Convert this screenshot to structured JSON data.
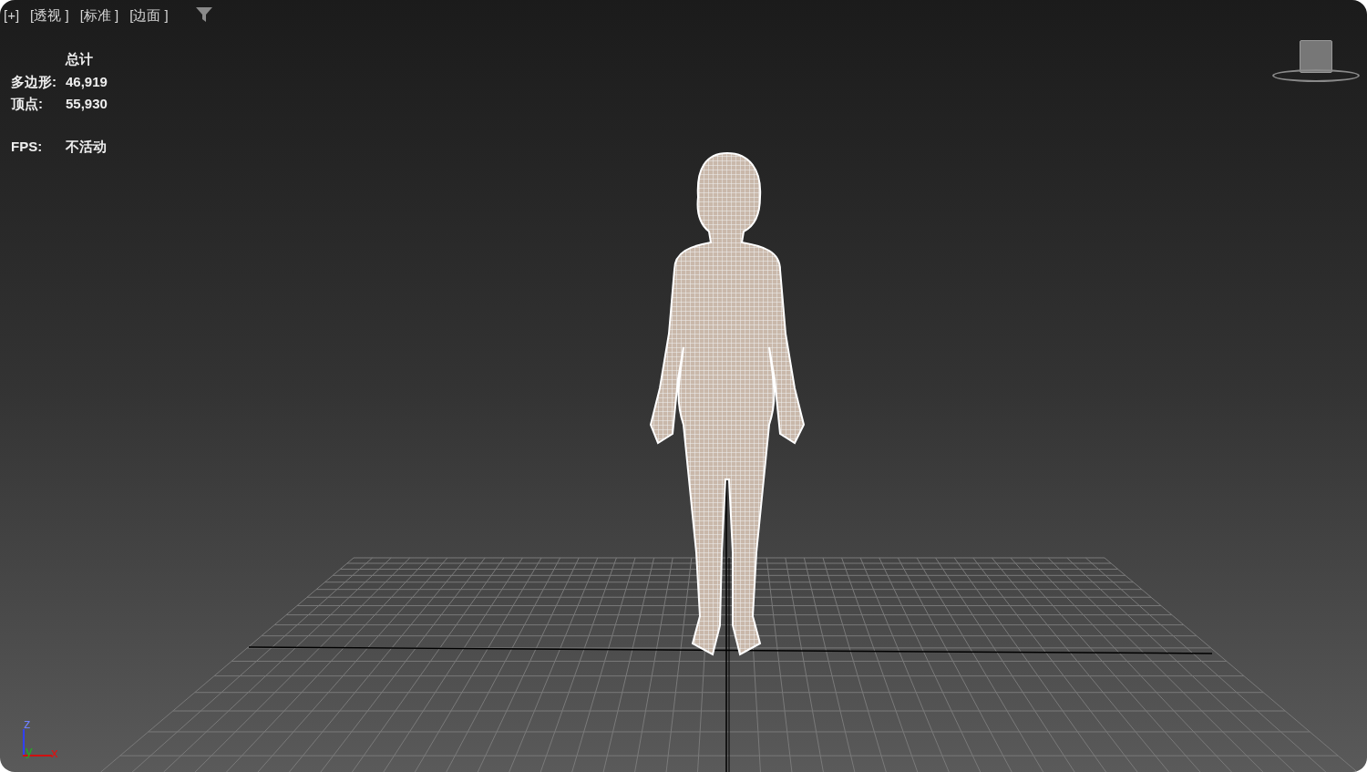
{
  "viewport_menu": [
    "[+]",
    "[透视 ]",
    "[标准 ]",
    "[边面 ]"
  ],
  "stats": {
    "header": "总计",
    "rows": [
      {
        "label": "多边形:",
        "value": "46,919"
      },
      {
        "label": "顶点:",
        "value": "55,930"
      }
    ],
    "fps": {
      "label": "FPS:",
      "value": "不活动"
    }
  },
  "axis_tripod": {
    "z": "z",
    "y": "y",
    "x": "x"
  }
}
